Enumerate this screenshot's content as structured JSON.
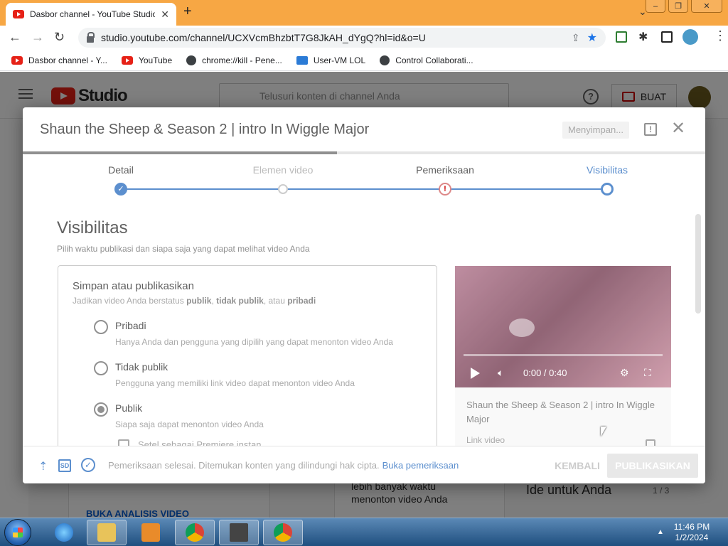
{
  "browser": {
    "tab_title": "Dasbor channel - YouTube Studio",
    "url": "studio.youtube.com/channel/UCXVcmBhzbtT7G8JkAH_dYgQ?hl=id&o=U",
    "bookmarks": [
      {
        "label": "Dasbor channel - Y..."
      },
      {
        "label": "YouTube"
      },
      {
        "label": "chrome://kill - Pene..."
      },
      {
        "label": "User-VM LOL"
      },
      {
        "label": "Control Collaborati..."
      }
    ]
  },
  "studio": {
    "logo_text": "Studio",
    "search_placeholder": "Telusuri konten di channel Anda",
    "create_label": "BUAT",
    "bg_texts": {
      "analytics_link": "BUKA ANALISIS VIDEO",
      "card_line1": "lebih banyak waktu",
      "card_line2": "menonton video Anda",
      "ideas_title": "Ide untuk Anda",
      "ideas_pager": "1 / 3"
    }
  },
  "dialog": {
    "title": "Shaun the Sheep & Season 2 | intro In Wiggle Major",
    "saving_label": "Menyimpan...",
    "upload_progress": 0.46,
    "steps": [
      {
        "label": "Detail"
      },
      {
        "label": "Elemen video"
      },
      {
        "label": "Pemeriksaan"
      },
      {
        "label": "Visibilitas"
      }
    ],
    "section_title": "Visibilitas",
    "section_sub": "Pilih waktu publikasi dan siapa saja yang dapat melihat video Anda",
    "box": {
      "title": "Simpan atau publikasikan",
      "sub_prefix": "Jadikan video Anda berstatus",
      "sub_public": "publik",
      "sub_sep": ",",
      "sub_unlisted": "tidak publik",
      "sub_or": ", atau",
      "sub_private": "pribadi",
      "options": [
        {
          "label": "Pribadi",
          "desc": "Hanya Anda dan pengguna yang dipilih yang dapat menonton video Anda"
        },
        {
          "label": "Tidak publik",
          "desc": "Pengguna yang memiliki link video dapat menonton video Anda"
        },
        {
          "label": "Publik",
          "desc": "Siapa saja dapat menonton video Anda"
        }
      ],
      "premiere_label": "Setel sebagai Premiere instan"
    },
    "preview": {
      "time": "0:00 / 0:40",
      "video_title": "Shaun the Sheep & Season 2 | intro In Wiggle Major",
      "link_label": "Link video"
    },
    "footer": {
      "status_text": "Pemeriksaan selesai. Ditemukan konten yang dilindungi hak cipta.",
      "status_link": "Buka pemeriksaan",
      "back_label": "KEMBALI",
      "publish_label": "PUBLIKASIKAN"
    }
  },
  "taskbar": {
    "time": "11:46 PM",
    "date": "1/2/2024"
  }
}
